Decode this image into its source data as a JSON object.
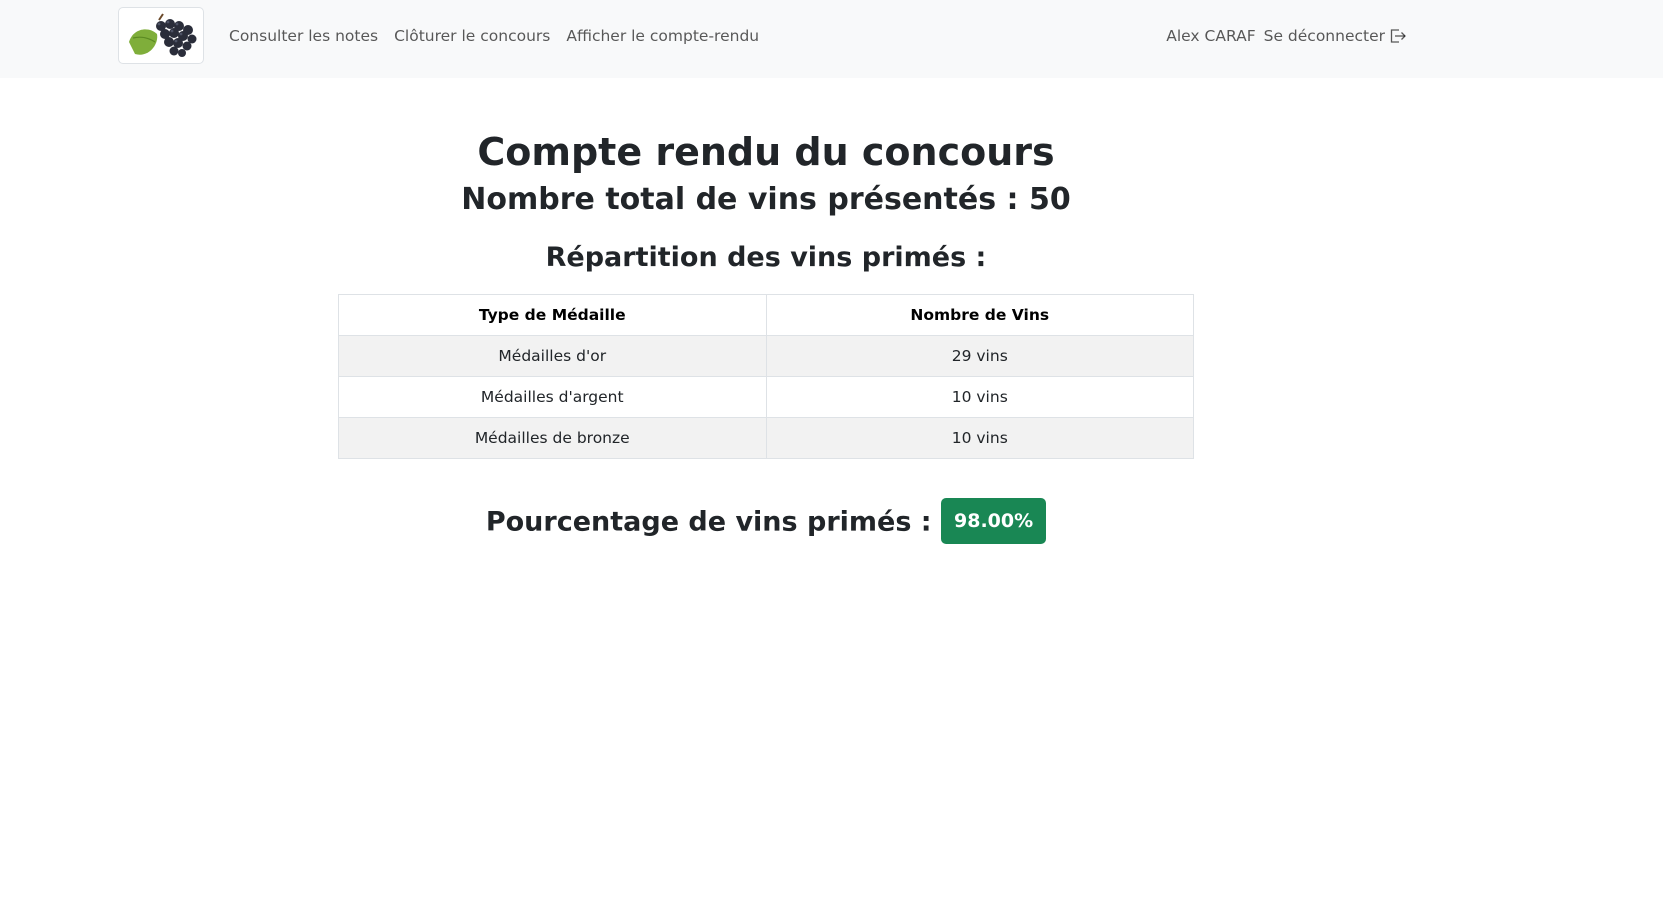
{
  "nav": {
    "links": [
      "Consulter les notes",
      "Clôturer le concours",
      "Afficher le compte-rendu"
    ],
    "user": "Alex CARAF",
    "logout_label": "Se déconnecter",
    "logout_icon": "logout-icon",
    "brand_icon": "grapes-logo"
  },
  "report": {
    "title": "Compte rendu du concours",
    "total_label": "Nombre total de vins présentés :",
    "total_value": "50",
    "distribution_title": "Répartition des vins primés :",
    "table": {
      "headers": [
        "Type de Médaille",
        "Nombre de Vins"
      ],
      "rows": [
        [
          "Médailles d'or",
          "29 vins"
        ],
        [
          "Médailles d'argent",
          "10 vins"
        ],
        [
          "Médailles de bronze",
          "10 vins"
        ]
      ]
    },
    "percentage_label": "Pourcentage de vins primés :",
    "percentage_value": "98.00%"
  },
  "colors": {
    "navbar_bg": "#f8f9fa",
    "badge_bg": "#198754"
  }
}
